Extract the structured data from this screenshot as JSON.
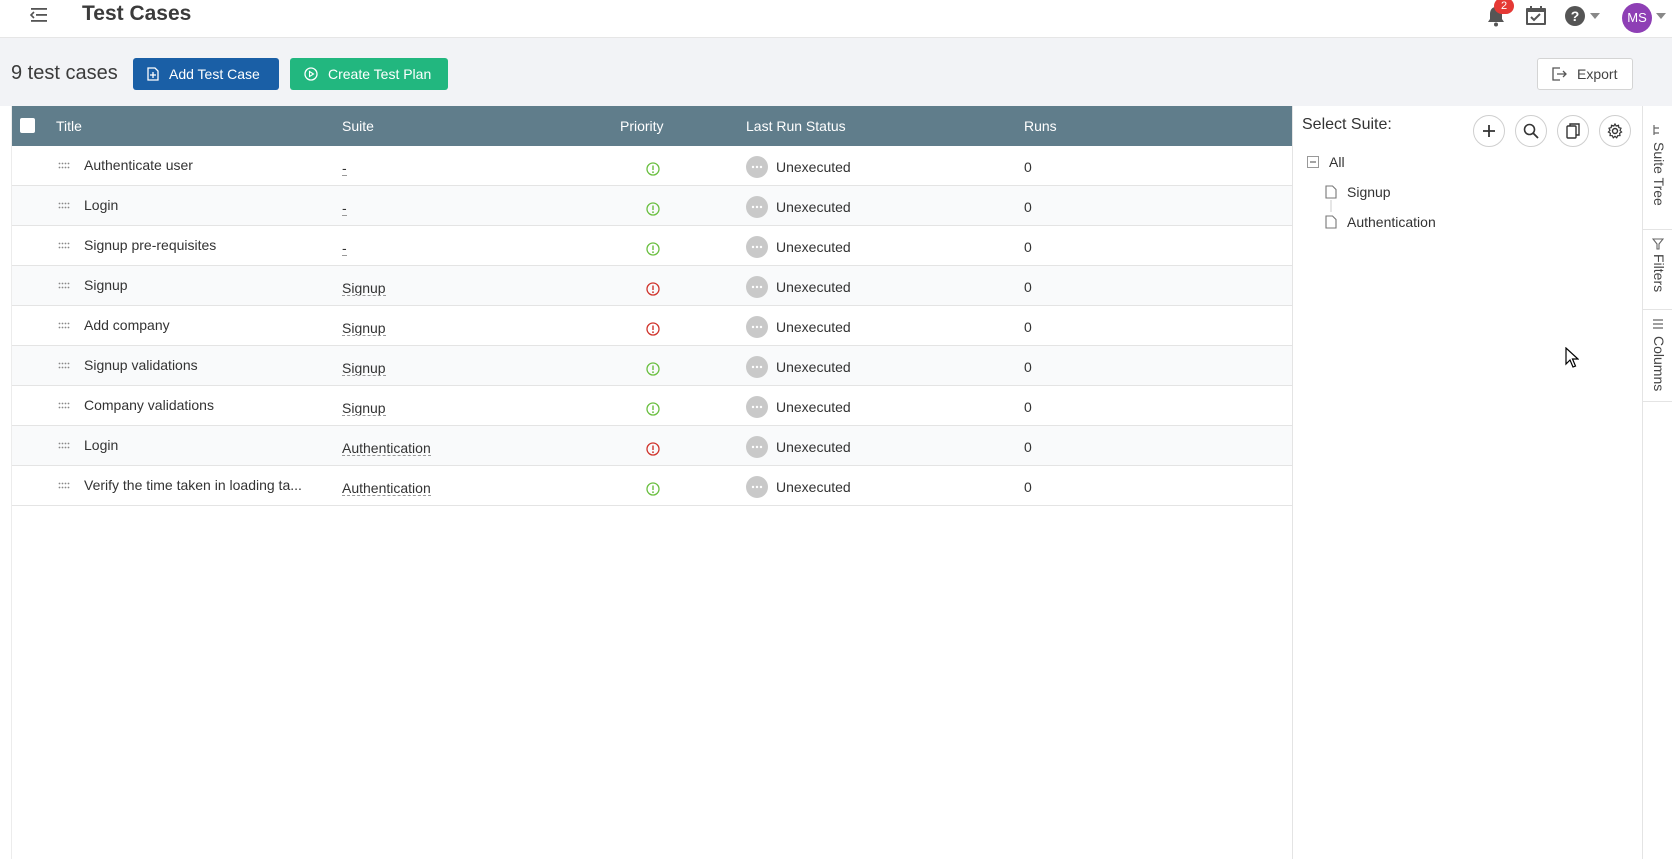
{
  "header": {
    "title": "Test Cases",
    "notification_count": "2",
    "avatar_initials": "MS"
  },
  "toolbar": {
    "count_label": "9 test cases",
    "add_label": "Add Test Case",
    "plan_label": "Create Test Plan",
    "export_label": "Export"
  },
  "table": {
    "columns": [
      "Title",
      "Suite",
      "Priority",
      "Last Run Status",
      "Runs"
    ],
    "rows": [
      {
        "title": "Authenticate user",
        "suite": "-",
        "priority": "normal",
        "status": "Unexecuted",
        "runs": "0"
      },
      {
        "title": "Login",
        "suite": "-",
        "priority": "normal",
        "status": "Unexecuted",
        "runs": "0"
      },
      {
        "title": "Signup pre-requisites",
        "suite": "-",
        "priority": "normal",
        "status": "Unexecuted",
        "runs": "0"
      },
      {
        "title": "Signup",
        "suite": "Signup",
        "priority": "high",
        "status": "Unexecuted",
        "runs": "0"
      },
      {
        "title": "Add company",
        "suite": "Signup",
        "priority": "high",
        "status": "Unexecuted",
        "runs": "0"
      },
      {
        "title": "Signup validations",
        "suite": "Signup",
        "priority": "normal",
        "status": "Unexecuted",
        "runs": "0"
      },
      {
        "title": "Company validations",
        "suite": "Signup",
        "priority": "normal",
        "status": "Unexecuted",
        "runs": "0"
      },
      {
        "title": "Login",
        "suite": "Authentication",
        "priority": "high",
        "status": "Unexecuted",
        "runs": "0"
      },
      {
        "title": "Verify the time taken in loading ta...",
        "suite": "Authentication",
        "priority": "normal",
        "status": "Unexecuted",
        "runs": "0"
      }
    ]
  },
  "suite_panel": {
    "label": "Select Suite:",
    "tree": {
      "root": "All",
      "children": [
        "Signup",
        "Authentication"
      ]
    }
  },
  "side_tabs": [
    "Suite Tree",
    "Filters",
    "Columns"
  ],
  "colors": {
    "primary": "#1a5fa6",
    "success": "#22b77f",
    "table_header": "#607d8b",
    "priority_normal": "#6abf40",
    "priority_high": "#d0342c"
  }
}
